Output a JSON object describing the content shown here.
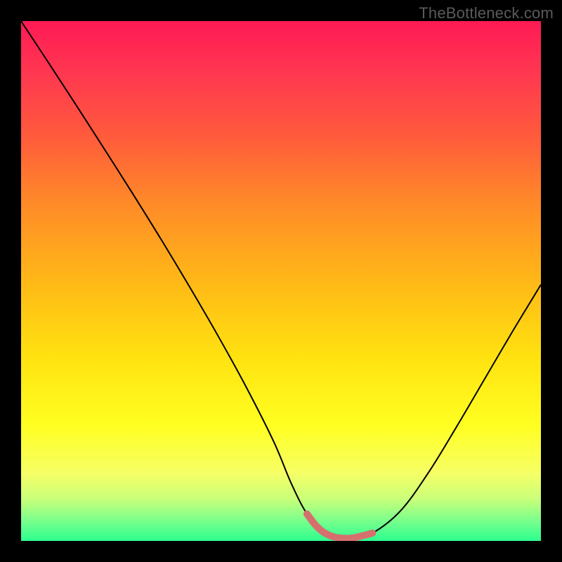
{
  "watermark": "TheBottleneck.com",
  "gradient_stops": [
    {
      "offset": 0.0,
      "color": "#ff1a55"
    },
    {
      "offset": 0.1,
      "color": "#ff3750"
    },
    {
      "offset": 0.22,
      "color": "#ff5a3c"
    },
    {
      "offset": 0.35,
      "color": "#ff8a28"
    },
    {
      "offset": 0.5,
      "color": "#ffb817"
    },
    {
      "offset": 0.65,
      "color": "#ffe310"
    },
    {
      "offset": 0.78,
      "color": "#ffff22"
    },
    {
      "offset": 0.87,
      "color": "#f6ff66"
    },
    {
      "offset": 0.92,
      "color": "#c8ff7a"
    },
    {
      "offset": 0.96,
      "color": "#7cff8c"
    },
    {
      "offset": 1.0,
      "color": "#2cff8f"
    }
  ],
  "curve_style": {
    "color": "#000000",
    "width": 2
  },
  "marker_style": {
    "color": "#d6706e",
    "width": 10,
    "cap": "round"
  },
  "chart_data": {
    "type": "line",
    "title": "",
    "xlabel": "",
    "ylabel": "",
    "xlim": [
      0,
      100
    ],
    "ylim": [
      0,
      100
    ],
    "legend": false,
    "grid": false,
    "series": [
      {
        "name": "bottleneck-curve",
        "x": [
          0,
          5.4,
          10.8,
          16.2,
          21.6,
          27.0,
          32.4,
          37.8,
          43.2,
          48.6,
          52.0,
          55.0,
          58.0,
          61.0,
          64.0,
          67.6,
          73.0,
          78.4,
          83.8,
          89.2,
          94.6,
          100.0
        ],
        "y": [
          100,
          91.8,
          83.5,
          75.1,
          66.6,
          57.9,
          48.9,
          39.6,
          29.8,
          19.1,
          11.0,
          5.2,
          1.8,
          0.6,
          0.6,
          1.5,
          5.8,
          13.2,
          22.0,
          31.2,
          40.4,
          49.3
        ]
      },
      {
        "name": "optimal-region-markers",
        "x": [
          55.0,
          56.5,
          58.0,
          59.5,
          61.0,
          62.5,
          64.0,
          67.6
        ],
        "y": [
          5.2,
          3.2,
          1.8,
          1.0,
          0.6,
          0.5,
          0.6,
          1.5
        ]
      }
    ]
  }
}
